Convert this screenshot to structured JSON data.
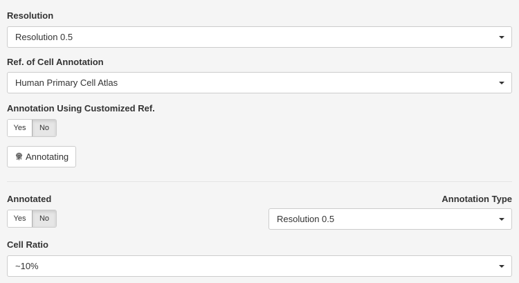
{
  "resolution": {
    "label": "Resolution",
    "value": "Resolution 0.5"
  },
  "ref_annotation": {
    "label": "Ref. of Cell Annotation",
    "value": "Human Primary Cell Atlas"
  },
  "customized_ref": {
    "label": "Annotation Using Customized Ref.",
    "yes_label": "Yes",
    "no_label": "No",
    "selected": "No"
  },
  "annotate_button": {
    "label": "Annotating",
    "icon": "fingerprint-icon"
  },
  "annotated": {
    "label": "Annotated",
    "yes_label": "Yes",
    "no_label": "No",
    "selected": "No"
  },
  "annotation_type": {
    "label": "Annotation Type",
    "value": "Resolution 0.5"
  },
  "cell_ratio": {
    "label": "Cell Ratio",
    "value": "~10%"
  }
}
